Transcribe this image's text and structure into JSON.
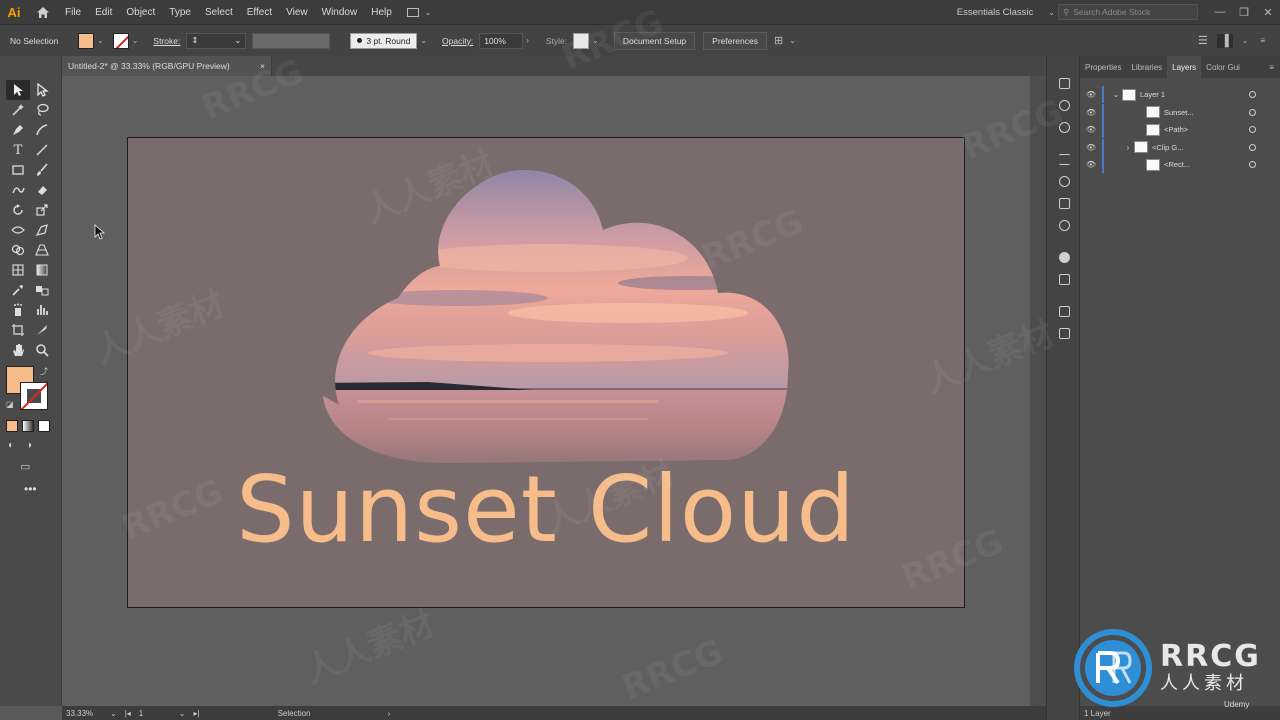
{
  "app": {
    "logo": "Ai",
    "workspace": "Essentials Classic",
    "search_placeholder": "Search Adobe Stock"
  },
  "menu": [
    "File",
    "Edit",
    "Object",
    "Type",
    "Select",
    "Effect",
    "View",
    "Window",
    "Help"
  ],
  "control_bar": {
    "selection": "No Selection",
    "stroke_label": "Stroke:",
    "brush": "3 pt. Round",
    "opacity_label": "Opacity:",
    "opacity_value": "100%",
    "style_label": "Style:",
    "document_setup": "Document Setup",
    "preferences": "Preferences",
    "fill_color": "#f6bd8b"
  },
  "document": {
    "tab_title": "Untitled-2* @ 33.33% (RGB/GPU Preview)",
    "close": "×"
  },
  "artwork": {
    "title": "Sunset Cloud",
    "text_color": "#f6bd8b",
    "artboard_color": "#7a6c6c"
  },
  "status_bar": {
    "zoom": "33.33%",
    "artboard_number": "1",
    "tool": "Selection"
  },
  "panel": {
    "tabs": [
      "Properties",
      "Libraries",
      "Layers",
      "Color Gui"
    ],
    "active_tab": "Layers",
    "layers": [
      {
        "name": "Layer 1",
        "expanded": true
      },
      {
        "name": "Sunset..."
      },
      {
        "name": "<Path>"
      },
      {
        "name": "<Clip G..."
      },
      {
        "name": "<Rect..."
      }
    ],
    "footer": "1 Layer"
  },
  "watermark": {
    "brand": "RRCG",
    "brand_cn": "人人素材",
    "udemy": "Udemy"
  }
}
